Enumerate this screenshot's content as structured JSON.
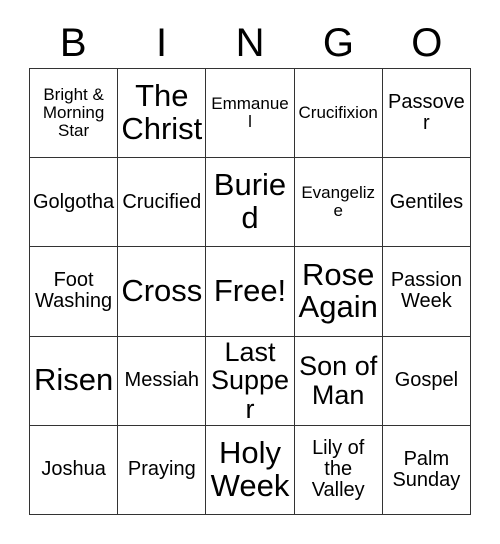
{
  "card": {
    "title": "Bingo Card",
    "header": {
      "letters": [
        "B",
        "I",
        "N",
        "G",
        "O"
      ]
    },
    "colors": {
      "background": "#ffffff",
      "text": "#000000",
      "grid_line": "#333333"
    },
    "grid": {
      "columns": 5,
      "rows": 5,
      "free_space": "Free!",
      "rows_data": [
        [
          {
            "text": "Bright & Morning Star",
            "size": "sm"
          },
          {
            "text": "The Christ",
            "size": "xxl"
          },
          {
            "text": "Emmanuel",
            "size": "sm"
          },
          {
            "text": "Crucifixion",
            "size": "sm"
          },
          {
            "text": "Passover",
            "size": "md"
          }
        ],
        [
          {
            "text": "Golgotha",
            "size": "md"
          },
          {
            "text": "Crucified",
            "size": "md"
          },
          {
            "text": "Buried",
            "size": "xxl"
          },
          {
            "text": "Evangelize",
            "size": "sm"
          },
          {
            "text": "Gentiles",
            "size": "md"
          }
        ],
        [
          {
            "text": "Foot Washing",
            "size": "md"
          },
          {
            "text": "Cross",
            "size": "xxl"
          },
          {
            "text": "Free!",
            "size": "xxl"
          },
          {
            "text": "Rose Again",
            "size": "xxl"
          },
          {
            "text": "Passion Week",
            "size": "md"
          }
        ],
        [
          {
            "text": "Risen",
            "size": "xxl"
          },
          {
            "text": "Messiah",
            "size": "md"
          },
          {
            "text": "Last Supper",
            "size": "xl"
          },
          {
            "text": "Son of Man",
            "size": "xl"
          },
          {
            "text": "Gospel",
            "size": "md"
          }
        ],
        [
          {
            "text": "Joshua",
            "size": "md"
          },
          {
            "text": "Praying",
            "size": "md"
          },
          {
            "text": "Holy Week",
            "size": "xxl"
          },
          {
            "text": "Lily of the Valley",
            "size": "md"
          },
          {
            "text": "Palm Sunday",
            "size": "md"
          }
        ]
      ]
    }
  }
}
